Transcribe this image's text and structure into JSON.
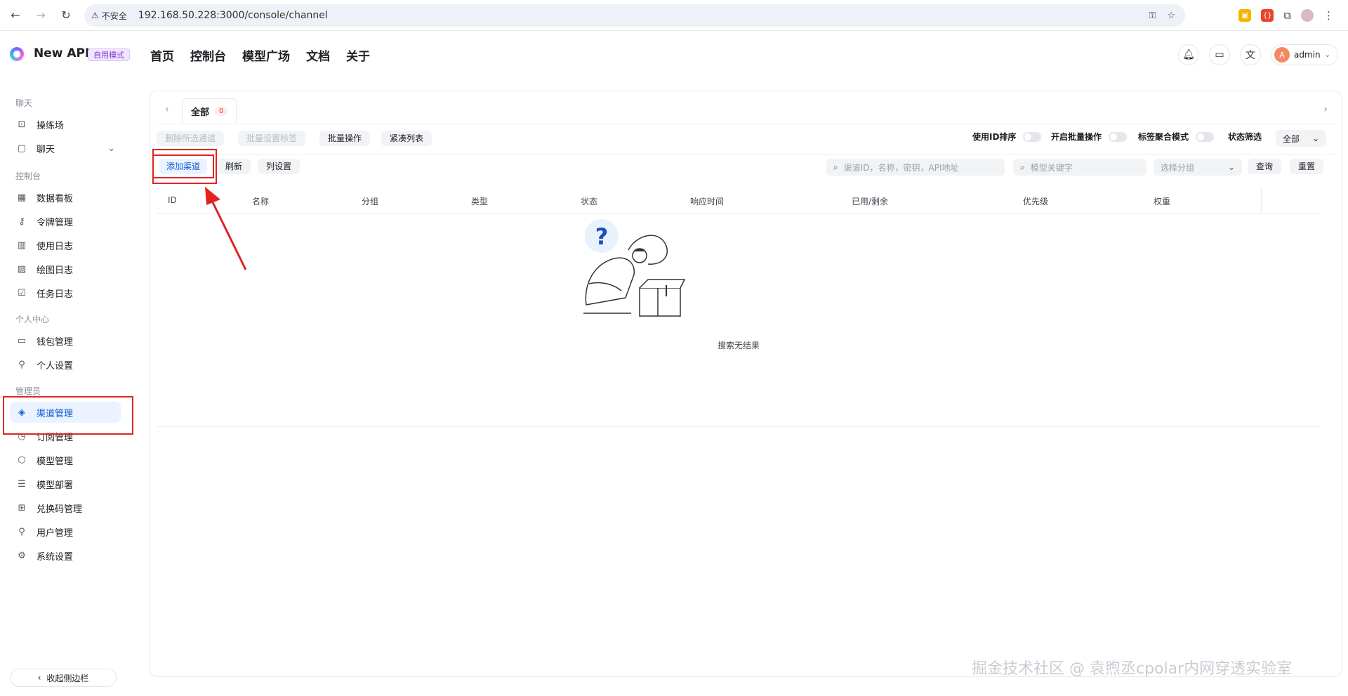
{
  "browser": {
    "security_label": "不安全",
    "url": "192.168.50.228:3000/console/channel"
  },
  "header": {
    "brand": "New API",
    "mode_badge": "自用模式",
    "nav": [
      "首页",
      "控制台",
      "模型广场",
      "文档",
      "关于"
    ],
    "user": {
      "name": "admin",
      "avatar_letter": "A"
    }
  },
  "sidebar": {
    "groups": [
      {
        "label": "聊天",
        "items": [
          {
            "label": "操练场",
            "icon": "terminal-icon"
          },
          {
            "label": "聊天",
            "icon": "chat-icon",
            "has_children": true
          }
        ]
      },
      {
        "label": "控制台",
        "items": [
          {
            "label": "数据看板",
            "icon": "dashboard-icon"
          },
          {
            "label": "令牌管理",
            "icon": "key-icon"
          },
          {
            "label": "使用日志",
            "icon": "chart-icon"
          },
          {
            "label": "绘图日志",
            "icon": "image-icon"
          },
          {
            "label": "任务日志",
            "icon": "checkbox-icon"
          }
        ]
      },
      {
        "label": "个人中心",
        "items": [
          {
            "label": "钱包管理",
            "icon": "wallet-icon"
          },
          {
            "label": "个人设置",
            "icon": "user-icon"
          }
        ]
      },
      {
        "label": "管理员",
        "items": [
          {
            "label": "渠道管理",
            "icon": "layers-icon",
            "active": true
          },
          {
            "label": "订阅管理",
            "icon": "subscription-icon"
          },
          {
            "label": "模型管理",
            "icon": "cube-icon"
          },
          {
            "label": "模型部署",
            "icon": "server-icon"
          },
          {
            "label": "兑换码管理",
            "icon": "gift-icon"
          },
          {
            "label": "用户管理",
            "icon": "user-icon"
          },
          {
            "label": "系统设置",
            "icon": "gear-icon"
          }
        ]
      }
    ],
    "collapse_label": "收起侧边栏"
  },
  "main": {
    "tab": {
      "label": "全部",
      "count": "0"
    },
    "toolbar1": {
      "delete_selected": "删除所选通道",
      "batch_tag": "批量设置标签",
      "batch_ops": "批量操作",
      "compact_list": "紧凑列表",
      "sort_by_id": "使用ID排序",
      "enable_batch": "开启批量操作",
      "tag_aggregate": "标签聚合模式",
      "status_filter": "状态筛选",
      "status_value": "全部"
    },
    "toolbar2": {
      "add_channel": "添加渠道",
      "refresh": "刷新",
      "column_settings": "列设置",
      "search_placeholder": "渠道ID，名称，密钥，API地址",
      "model_placeholder": "模型关键字",
      "group_placeholder": "选择分组",
      "query": "查询",
      "reset": "重置"
    },
    "columns": [
      "ID",
      "名称",
      "分组",
      "类型",
      "状态",
      "响应时间",
      "已用/剩余",
      "优先级",
      "权重"
    ],
    "empty_text": "搜索无结果"
  },
  "watermark": "掘金技术社区 @ 袁煦丞cpolar内网穿透实验室",
  "colors": {
    "accent": "#0f5bd9",
    "annotation": "#e02424"
  }
}
